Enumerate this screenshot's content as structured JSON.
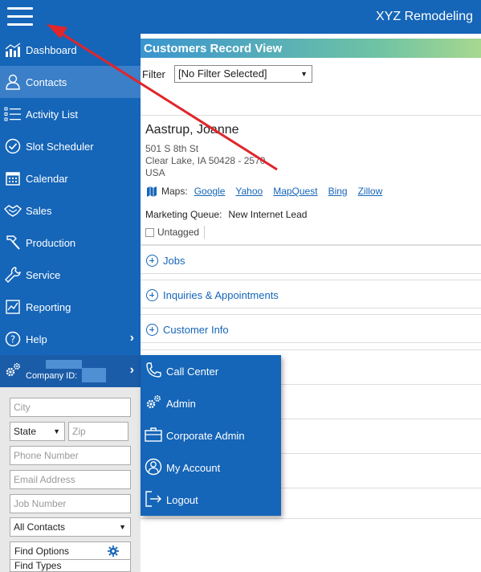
{
  "header": {
    "app_title": "XYZ Remodeling",
    "menu_icon": "hamburger-icon"
  },
  "sidebar": {
    "items": [
      {
        "label": "Dashboard",
        "icon": "dashboard-chart-icon"
      },
      {
        "label": "Contacts",
        "icon": "contacts-person-icon",
        "active": true
      },
      {
        "label": "Activity List",
        "icon": "activity-list-icon"
      },
      {
        "label": "Slot Scheduler",
        "icon": "check-circle-icon"
      },
      {
        "label": "Calendar",
        "icon": "calendar-icon"
      },
      {
        "label": "Sales",
        "icon": "handshake-icon"
      },
      {
        "label": "Production",
        "icon": "hammer-icon"
      },
      {
        "label": "Service",
        "icon": "wrench-icon"
      },
      {
        "label": "Reporting",
        "icon": "reporting-chart-icon"
      },
      {
        "label": "Help",
        "icon": "help-circle-icon"
      }
    ],
    "company_label": "Company ID:"
  },
  "submenu": {
    "items": [
      {
        "label": "Call Center",
        "icon": "phone-icon"
      },
      {
        "label": "Admin",
        "icon": "gears-icon"
      },
      {
        "label": "Corporate Admin",
        "icon": "briefcase-icon"
      },
      {
        "label": "My Account",
        "icon": "user-circle-icon"
      },
      {
        "label": "Logout",
        "icon": "logout-icon"
      }
    ]
  },
  "main": {
    "page_title": "Customers Record View",
    "filter_label": "Filter",
    "filter_value": "[No Filter Selected]",
    "customer": {
      "name": "Aastrup, Joanne",
      "address_line1": "501 S 8th St",
      "address_line2": "Clear Lake, IA 50428 - 2570",
      "country": "USA",
      "maps_label": "Maps:",
      "map_links": [
        "Google",
        "Yahoo",
        "MapQuest",
        "Bing",
        "Zillow"
      ],
      "marketing_queue_label": "Marketing Queue:",
      "marketing_queue_value": "New Internet Lead",
      "tag_label": "Untagged"
    },
    "sections": [
      "Jobs",
      "Inquiries & Appointments",
      "Customer Info"
    ]
  },
  "search_panel": {
    "city_placeholder": "City",
    "state_value": "State",
    "zip_placeholder": "Zip",
    "phone_placeholder": "Phone Number",
    "email_placeholder": "Email Address",
    "job_placeholder": "Job Number",
    "contacts_filter_value": "All Contacts",
    "find_options_label": "Find Options",
    "find_types_label": "Find Types"
  },
  "colors": {
    "primary_blue": "#1565b8",
    "active_item": "#3a7fc8",
    "annotation_arrow": "#e0262b"
  }
}
